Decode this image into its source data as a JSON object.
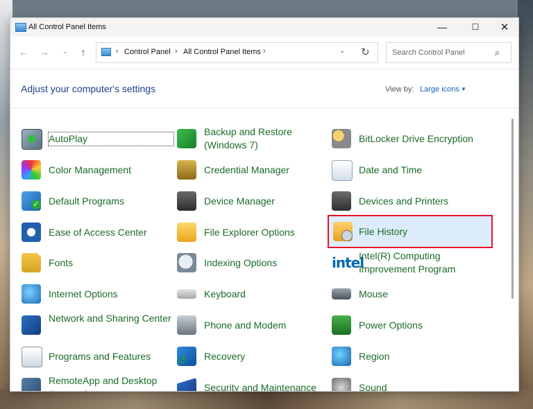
{
  "window": {
    "title": "All Control Panel Items",
    "controls": {
      "minimize": "—",
      "maximize": "☐",
      "close": "✕"
    }
  },
  "nav": {
    "back": "←",
    "forward": "→",
    "recent": "⌄",
    "up": "↑",
    "breadcrumb": [
      "Control Panel",
      "All Control Panel Items"
    ],
    "dropdown": "⌄",
    "refresh": "↻",
    "search_placeholder": "Search Control Panel",
    "search_icon": "⌕"
  },
  "header": {
    "heading": "Adjust your computer's settings",
    "viewby_label": "View by:",
    "viewby_value": "Large icons",
    "viewby_caret": "▼"
  },
  "items": [
    {
      "label": "AutoPlay",
      "icon": "autoplay-icon"
    },
    {
      "label": "Backup and Restore (Windows 7)",
      "icon": "backup-icon"
    },
    {
      "label": "BitLocker Drive Encryption",
      "icon": "bitlocker-icon"
    },
    {
      "label": "Color Management",
      "icon": "color-management-icon"
    },
    {
      "label": "Credential Manager",
      "icon": "credential-icon"
    },
    {
      "label": "Date and Time",
      "icon": "date-time-icon"
    },
    {
      "label": "Default Programs",
      "icon": "default-programs-icon"
    },
    {
      "label": "Device Manager",
      "icon": "device-manager-icon"
    },
    {
      "label": "Devices and Printers",
      "icon": "printer-icon"
    },
    {
      "label": "Ease of Access Center",
      "icon": "ease-of-access-icon"
    },
    {
      "label": "File Explorer Options",
      "icon": "folder-options-icon"
    },
    {
      "label": "File History",
      "icon": "file-history-icon"
    },
    {
      "label": "Fonts",
      "icon": "fonts-icon"
    },
    {
      "label": "Indexing Options",
      "icon": "indexing-icon"
    },
    {
      "label": "Intel(R) Computing Improvement Program",
      "icon": "intel-icon",
      "icon_text": "intel"
    },
    {
      "label": "Internet Options",
      "icon": "internet-options-icon"
    },
    {
      "label": "Keyboard",
      "icon": "keyboard-icon"
    },
    {
      "label": "Mouse",
      "icon": "mouse-icon"
    },
    {
      "label": "Network and Sharing Center",
      "icon": "network-icon"
    },
    {
      "label": "Phone and Modem",
      "icon": "phone-modem-icon"
    },
    {
      "label": "Power Options",
      "icon": "power-icon"
    },
    {
      "label": "Programs and Features",
      "icon": "programs-icon"
    },
    {
      "label": "Recovery",
      "icon": "recovery-icon"
    },
    {
      "label": "Region",
      "icon": "region-icon"
    },
    {
      "label": "RemoteApp and Desktop Connections",
      "icon": "remoteapp-icon"
    },
    {
      "label": "Security and Maintenance",
      "icon": "security-icon"
    },
    {
      "label": "Sound",
      "icon": "sound-icon"
    }
  ],
  "highlighted_item": "File History",
  "colors": {
    "link": "#1a6b28",
    "heading": "#1e3f8a",
    "highlight_border": "#e8102b",
    "highlight_fill": "#ddecfb"
  }
}
